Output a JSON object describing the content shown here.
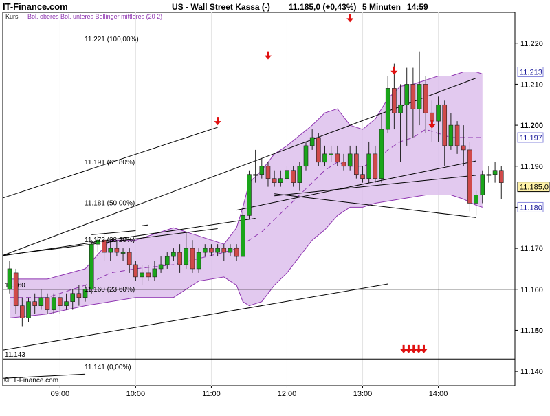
{
  "header": {
    "site": "IT-Finance.com",
    "title": "US - Wall Street Kassa (-)",
    "last": "11.185,0 (+0,43%)",
    "interval": "5 Minuten",
    "time": "14:59"
  },
  "legend": {
    "kurs": "Kurs",
    "bollinger": "Bol. oberes Bol. unteres Bollinger mittleres (20 2)"
  },
  "copyright": "© IT-Finance.com",
  "colors": {
    "up": "#1aa51a",
    "down": "#d04a4a",
    "band_fill": "#ddc0ec",
    "band_line": "#8e34b0",
    "middle_line": "#8e34b0",
    "arrow": "#e01010",
    "price_box": "#fff2a8",
    "axis_box_bg": "#ffffff",
    "axis_box_border": "#8888dd"
  },
  "chart_data": {
    "type": "candlestick",
    "ylim": [
      11.1365,
      11.2275
    ],
    "y_ticks": [
      "11.140",
      "11.150",
      "11.160",
      "11.170",
      "11.180",
      "11.190",
      "11.200",
      "11.210",
      "11.220"
    ],
    "x_ticks": [
      "09:00",
      "10:00",
      "11:00",
      "12:00",
      "13:00",
      "14:00"
    ],
    "x_tick_index": [
      8,
      20,
      32,
      44,
      56,
      68
    ],
    "candles": [
      [
        11.16,
        11.165,
        11.159,
        11.167
      ],
      [
        11.164,
        11.156,
        11.154,
        11.165
      ],
      [
        11.156,
        11.153,
        11.151,
        11.158
      ],
      [
        11.153,
        11.157,
        11.152,
        11.158
      ],
      [
        11.157,
        11.156,
        11.154,
        11.159
      ],
      [
        11.156,
        11.158,
        11.155,
        11.16
      ],
      [
        11.158,
        11.155,
        11.154,
        11.159
      ],
      [
        11.155,
        11.158,
        11.154,
        11.159
      ],
      [
        11.158,
        11.156,
        11.154,
        11.159
      ],
      [
        11.156,
        11.157,
        11.155,
        11.159
      ],
      [
        11.157,
        11.159,
        11.155,
        11.16
      ],
      [
        11.159,
        11.158,
        11.156,
        11.161
      ],
      [
        11.158,
        11.16,
        11.157,
        11.161
      ],
      [
        11.16,
        11.171,
        11.159,
        11.172
      ],
      [
        11.171,
        11.172,
        11.169,
        11.173
      ],
      [
        11.172,
        11.169,
        11.167,
        11.174
      ],
      [
        11.169,
        11.17,
        11.167,
        11.172
      ],
      [
        11.17,
        11.169,
        11.168,
        11.172
      ],
      [
        11.169,
        11.169,
        11.167,
        11.17
      ],
      [
        11.169,
        11.166,
        11.164,
        11.17
      ],
      [
        11.166,
        11.163,
        11.162,
        11.167
      ],
      [
        11.163,
        11.164,
        11.161,
        11.166
      ],
      [
        11.164,
        11.163,
        11.162,
        11.166
      ],
      [
        11.163,
        11.165,
        11.162,
        11.167
      ],
      [
        11.165,
        11.166,
        11.164,
        11.168
      ],
      [
        11.166,
        11.168,
        11.165,
        11.169
      ],
      [
        11.168,
        11.169,
        11.167,
        11.17
      ],
      [
        11.169,
        11.166,
        11.164,
        11.171
      ],
      [
        11.166,
        11.17,
        11.165,
        11.174
      ],
      [
        11.17,
        11.165,
        11.164,
        11.172
      ],
      [
        11.165,
        11.169,
        11.164,
        11.17
      ],
      [
        11.169,
        11.17,
        11.168,
        11.171
      ],
      [
        11.17,
        11.169,
        11.168,
        11.171
      ],
      [
        11.169,
        11.17,
        11.168,
        11.171
      ],
      [
        11.17,
        11.169,
        11.167,
        11.171
      ],
      [
        11.169,
        11.17,
        11.168,
        11.171
      ],
      [
        11.17,
        11.168,
        11.167,
        11.171
      ],
      [
        11.168,
        11.178,
        11.168,
        11.179
      ],
      [
        11.178,
        11.188,
        11.177,
        11.189
      ],
      [
        11.188,
        11.188,
        11.186,
        11.194
      ],
      [
        11.188,
        11.19,
        11.187,
        11.192
      ],
      [
        11.19,
        11.187,
        11.185,
        11.191
      ],
      [
        11.187,
        11.186,
        11.185,
        11.189
      ],
      [
        11.186,
        11.187,
        11.185,
        11.189
      ],
      [
        11.187,
        11.189,
        11.186,
        11.19
      ],
      [
        11.189,
        11.186,
        11.185,
        11.19
      ],
      [
        11.186,
        11.19,
        11.184,
        11.191
      ],
      [
        11.19,
        11.195,
        11.189,
        11.196
      ],
      [
        11.195,
        11.197,
        11.194,
        11.199
      ],
      [
        11.197,
        11.191,
        11.19,
        11.198
      ],
      [
        11.191,
        11.193,
        11.19,
        11.195
      ],
      [
        11.193,
        11.193,
        11.191,
        11.195
      ],
      [
        11.193,
        11.191,
        11.19,
        11.195
      ],
      [
        11.191,
        11.19,
        11.189,
        11.193
      ],
      [
        11.19,
        11.193,
        11.189,
        11.195
      ],
      [
        11.193,
        11.188,
        11.187,
        11.195
      ],
      [
        11.188,
        11.187,
        11.186,
        11.19
      ],
      [
        11.187,
        11.193,
        11.186,
        11.196
      ],
      [
        11.193,
        11.187,
        11.186,
        11.195
      ],
      [
        11.187,
        11.199,
        11.186,
        11.203
      ],
      [
        11.199,
        11.209,
        11.198,
        11.212
      ],
      [
        11.209,
        11.203,
        11.199,
        11.215
      ],
      [
        11.203,
        11.205,
        11.191,
        11.21
      ],
      [
        11.205,
        11.21,
        11.195,
        11.214
      ],
      [
        11.21,
        11.204,
        11.197,
        11.214
      ],
      [
        11.204,
        11.21,
        11.2,
        11.218
      ],
      [
        11.21,
        11.203,
        11.198,
        11.212
      ],
      [
        11.203,
        11.201,
        11.196,
        11.206
      ],
      [
        11.201,
        11.205,
        11.196,
        11.207
      ],
      [
        11.205,
        11.195,
        11.19,
        11.206
      ],
      [
        11.195,
        11.2,
        11.194,
        11.203
      ],
      [
        11.2,
        11.195,
        11.193,
        11.201
      ],
      [
        11.195,
        11.194,
        11.19,
        11.2
      ],
      [
        11.194,
        11.181,
        11.179,
        11.196
      ],
      [
        11.181,
        11.183,
        11.178,
        11.184
      ],
      [
        11.183,
        11.188,
        11.181,
        11.189
      ],
      [
        11.188,
        11.188,
        11.186,
        11.19
      ],
      [
        11.188,
        11.189,
        11.186,
        11.191
      ],
      [
        11.189,
        11.186,
        11.182,
        11.19
      ]
    ],
    "bollinger": {
      "upper": [
        [
          0,
          11.1625
        ],
        [
          6,
          11.1625
        ],
        [
          12,
          11.165
        ],
        [
          16,
          11.172
        ],
        [
          20,
          11.172
        ],
        [
          26,
          11.175
        ],
        [
          30,
          11.173
        ],
        [
          34,
          11.171
        ],
        [
          36,
          11.175
        ],
        [
          37,
          11.18
        ],
        [
          38,
          11.186
        ],
        [
          40,
          11.189
        ],
        [
          42,
          11.193
        ],
        [
          44,
          11.195
        ],
        [
          46,
          11.1975
        ],
        [
          48,
          11.2
        ],
        [
          50,
          11.203
        ],
        [
          52,
          11.204
        ],
        [
          54,
          11.2
        ],
        [
          56,
          11.199
        ],
        [
          58,
          11.2015
        ],
        [
          60,
          11.2065
        ],
        [
          62,
          11.2095
        ],
        [
          64,
          11.21
        ],
        [
          66,
          11.211
        ],
        [
          68,
          11.212
        ],
        [
          70,
          11.212
        ],
        [
          72,
          11.213
        ],
        [
          74,
          11.213
        ],
        [
          75,
          11.2125
        ]
      ],
      "lower": [
        [
          0,
          11.153
        ],
        [
          6,
          11.154
        ],
        [
          12,
          11.156
        ],
        [
          16,
          11.157
        ],
        [
          20,
          11.158
        ],
        [
          26,
          11.158
        ],
        [
          30,
          11.162
        ],
        [
          34,
          11.163
        ],
        [
          36,
          11.161
        ],
        [
          37,
          11.157
        ],
        [
          38,
          11.156
        ],
        [
          40,
          11.157
        ],
        [
          42,
          11.161
        ],
        [
          44,
          11.164
        ],
        [
          46,
          11.168
        ],
        [
          48,
          11.172
        ],
        [
          50,
          11.1745
        ],
        [
          52,
          11.178
        ],
        [
          54,
          11.18
        ],
        [
          56,
          11.18
        ],
        [
          58,
          11.181
        ],
        [
          60,
          11.1815
        ],
        [
          62,
          11.182
        ],
        [
          64,
          11.1825
        ],
        [
          66,
          11.183
        ],
        [
          68,
          11.183
        ],
        [
          70,
          11.183
        ],
        [
          72,
          11.182
        ],
        [
          74,
          11.1805
        ],
        [
          75,
          11.18
        ]
      ],
      "middle": [
        [
          0,
          11.158
        ],
        [
          6,
          11.158
        ],
        [
          12,
          11.161
        ],
        [
          16,
          11.164
        ],
        [
          20,
          11.165
        ],
        [
          26,
          11.166
        ],
        [
          30,
          11.1675
        ],
        [
          34,
          11.169
        ],
        [
          36,
          11.17
        ],
        [
          38,
          11.172
        ],
        [
          40,
          11.174
        ],
        [
          42,
          11.177
        ],
        [
          44,
          11.18
        ],
        [
          46,
          11.183
        ],
        [
          48,
          11.186
        ],
        [
          50,
          11.189
        ],
        [
          52,
          11.191
        ],
        [
          54,
          11.19
        ],
        [
          56,
          11.19
        ],
        [
          58,
          11.191
        ],
        [
          60,
          11.194
        ],
        [
          62,
          11.196
        ],
        [
          64,
          11.197
        ],
        [
          66,
          11.199
        ],
        [
          68,
          11.198
        ],
        [
          70,
          11.197
        ],
        [
          72,
          11.197
        ],
        [
          74,
          11.197
        ],
        [
          75,
          11.197
        ]
      ]
    },
    "fib_levels": [
      {
        "label": "11.221 (100,00%)",
        "value": 11.221
      },
      {
        "label": "11.191 (61,80%)",
        "value": 11.191
      },
      {
        "label": "11.181 (50,00%)",
        "value": 11.181
      },
      {
        "label": "11.172 (38,20%)",
        "value": 11.172
      },
      {
        "label": "11.160 (23,60%)",
        "value": 11.16
      },
      {
        "label": "11.141 (0,00%)",
        "value": 11.141
      }
    ],
    "hlines": [
      {
        "value": 11.16,
        "label": "11.160"
      },
      {
        "value": 11.143,
        "label": "11.143"
      }
    ],
    "trendlines": [
      [
        [
          -1,
          11.1823
        ],
        [
          33,
          11.1995
        ]
      ],
      [
        [
          -1,
          11.1683
        ],
        [
          74,
          11.2115
        ]
      ],
      [
        [
          -1,
          11.1683
        ],
        [
          33,
          11.1748
        ]
      ],
      [
        [
          -1,
          11.1682
        ],
        [
          39,
          11.1773
        ]
      ],
      [
        [
          -1,
          11.1452
        ],
        [
          60,
          11.1613
        ]
      ],
      [
        [
          36,
          11.1793
        ],
        [
          74,
          11.1913
        ]
      ],
      [
        [
          42,
          11.1828
        ],
        [
          74,
          11.1878
        ]
      ],
      [
        [
          42,
          11.1833
        ],
        [
          74,
          11.1775
        ]
      ],
      [
        [
          13,
          11.1733
        ],
        [
          20,
          11.1743
        ]
      ],
      [
        [
          21,
          11.1755
        ],
        [
          22,
          11.1757
        ]
      ],
      [
        [
          -1,
          11.1383
        ],
        [
          12,
          11.1393
        ]
      ]
    ],
    "sell_arrows": [
      {
        "index": 33,
        "value": 11.2005
      },
      {
        "index": 41,
        "value": 11.2165
      },
      {
        "index": 54,
        "value": 11.2256
      },
      {
        "index": 61,
        "value": 11.2128
      },
      {
        "index": 67,
        "value": 11.1997
      },
      {
        "index": 62.5,
        "value": 11.1449
      },
      {
        "index": 63.3,
        "value": 11.1449
      },
      {
        "index": 64.1,
        "value": 11.1449
      },
      {
        "index": 64.9,
        "value": 11.1449
      },
      {
        "index": 65.7,
        "value": 11.1449
      }
    ],
    "price_labels": [
      {
        "label": "11.213",
        "value": 11.213,
        "style": "box"
      },
      {
        "label": "11.197",
        "value": 11.197,
        "style": "box"
      },
      {
        "label": "11.185,0",
        "value": 11.185,
        "style": "current"
      },
      {
        "label": "11.180",
        "value": 11.18,
        "style": "box"
      }
    ]
  }
}
